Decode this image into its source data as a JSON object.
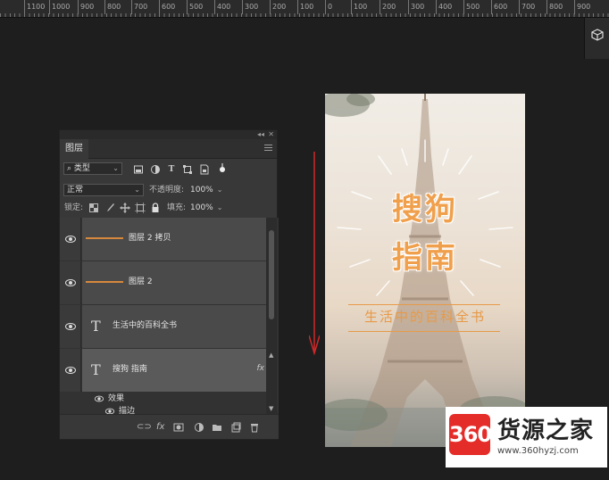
{
  "ruler": {
    "labels": [
      "1100",
      "1000",
      "900",
      "800",
      "700",
      "600",
      "500",
      "400",
      "300",
      "200",
      "100",
      "0",
      "100",
      "200",
      "300",
      "400",
      "500",
      "600",
      "700",
      "800",
      "900"
    ]
  },
  "layers_panel": {
    "tab_label": "图层",
    "filter": {
      "kind_label": "类型"
    },
    "blend_mode": "正常",
    "opacity_label": "不透明度:",
    "opacity_value": "100%",
    "lock_label": "锁定:",
    "fill_label": "填充:",
    "fill_value": "100%",
    "layers": [
      {
        "name": "图层 2 拷贝",
        "thumb": "line"
      },
      {
        "name": "图层 2",
        "thumb": "line"
      },
      {
        "name": "生活中的百科全书",
        "thumb": "text"
      },
      {
        "name": "搜狗 指南",
        "thumb": "text",
        "fx": "fx"
      }
    ],
    "effects_label": "效果",
    "stroke_label": "描边"
  },
  "poster": {
    "title_line1": "搜狗",
    "title_line2": "指南",
    "subtitle": "生活中的百科全书"
  },
  "watermark": {
    "logo_text": "360",
    "title": "货源之家",
    "url": "www.360hyzj.com"
  },
  "colors": {
    "accent_orange": "#f0a04c",
    "arrow_red": "#d0282a",
    "panel_bg": "#383838"
  }
}
